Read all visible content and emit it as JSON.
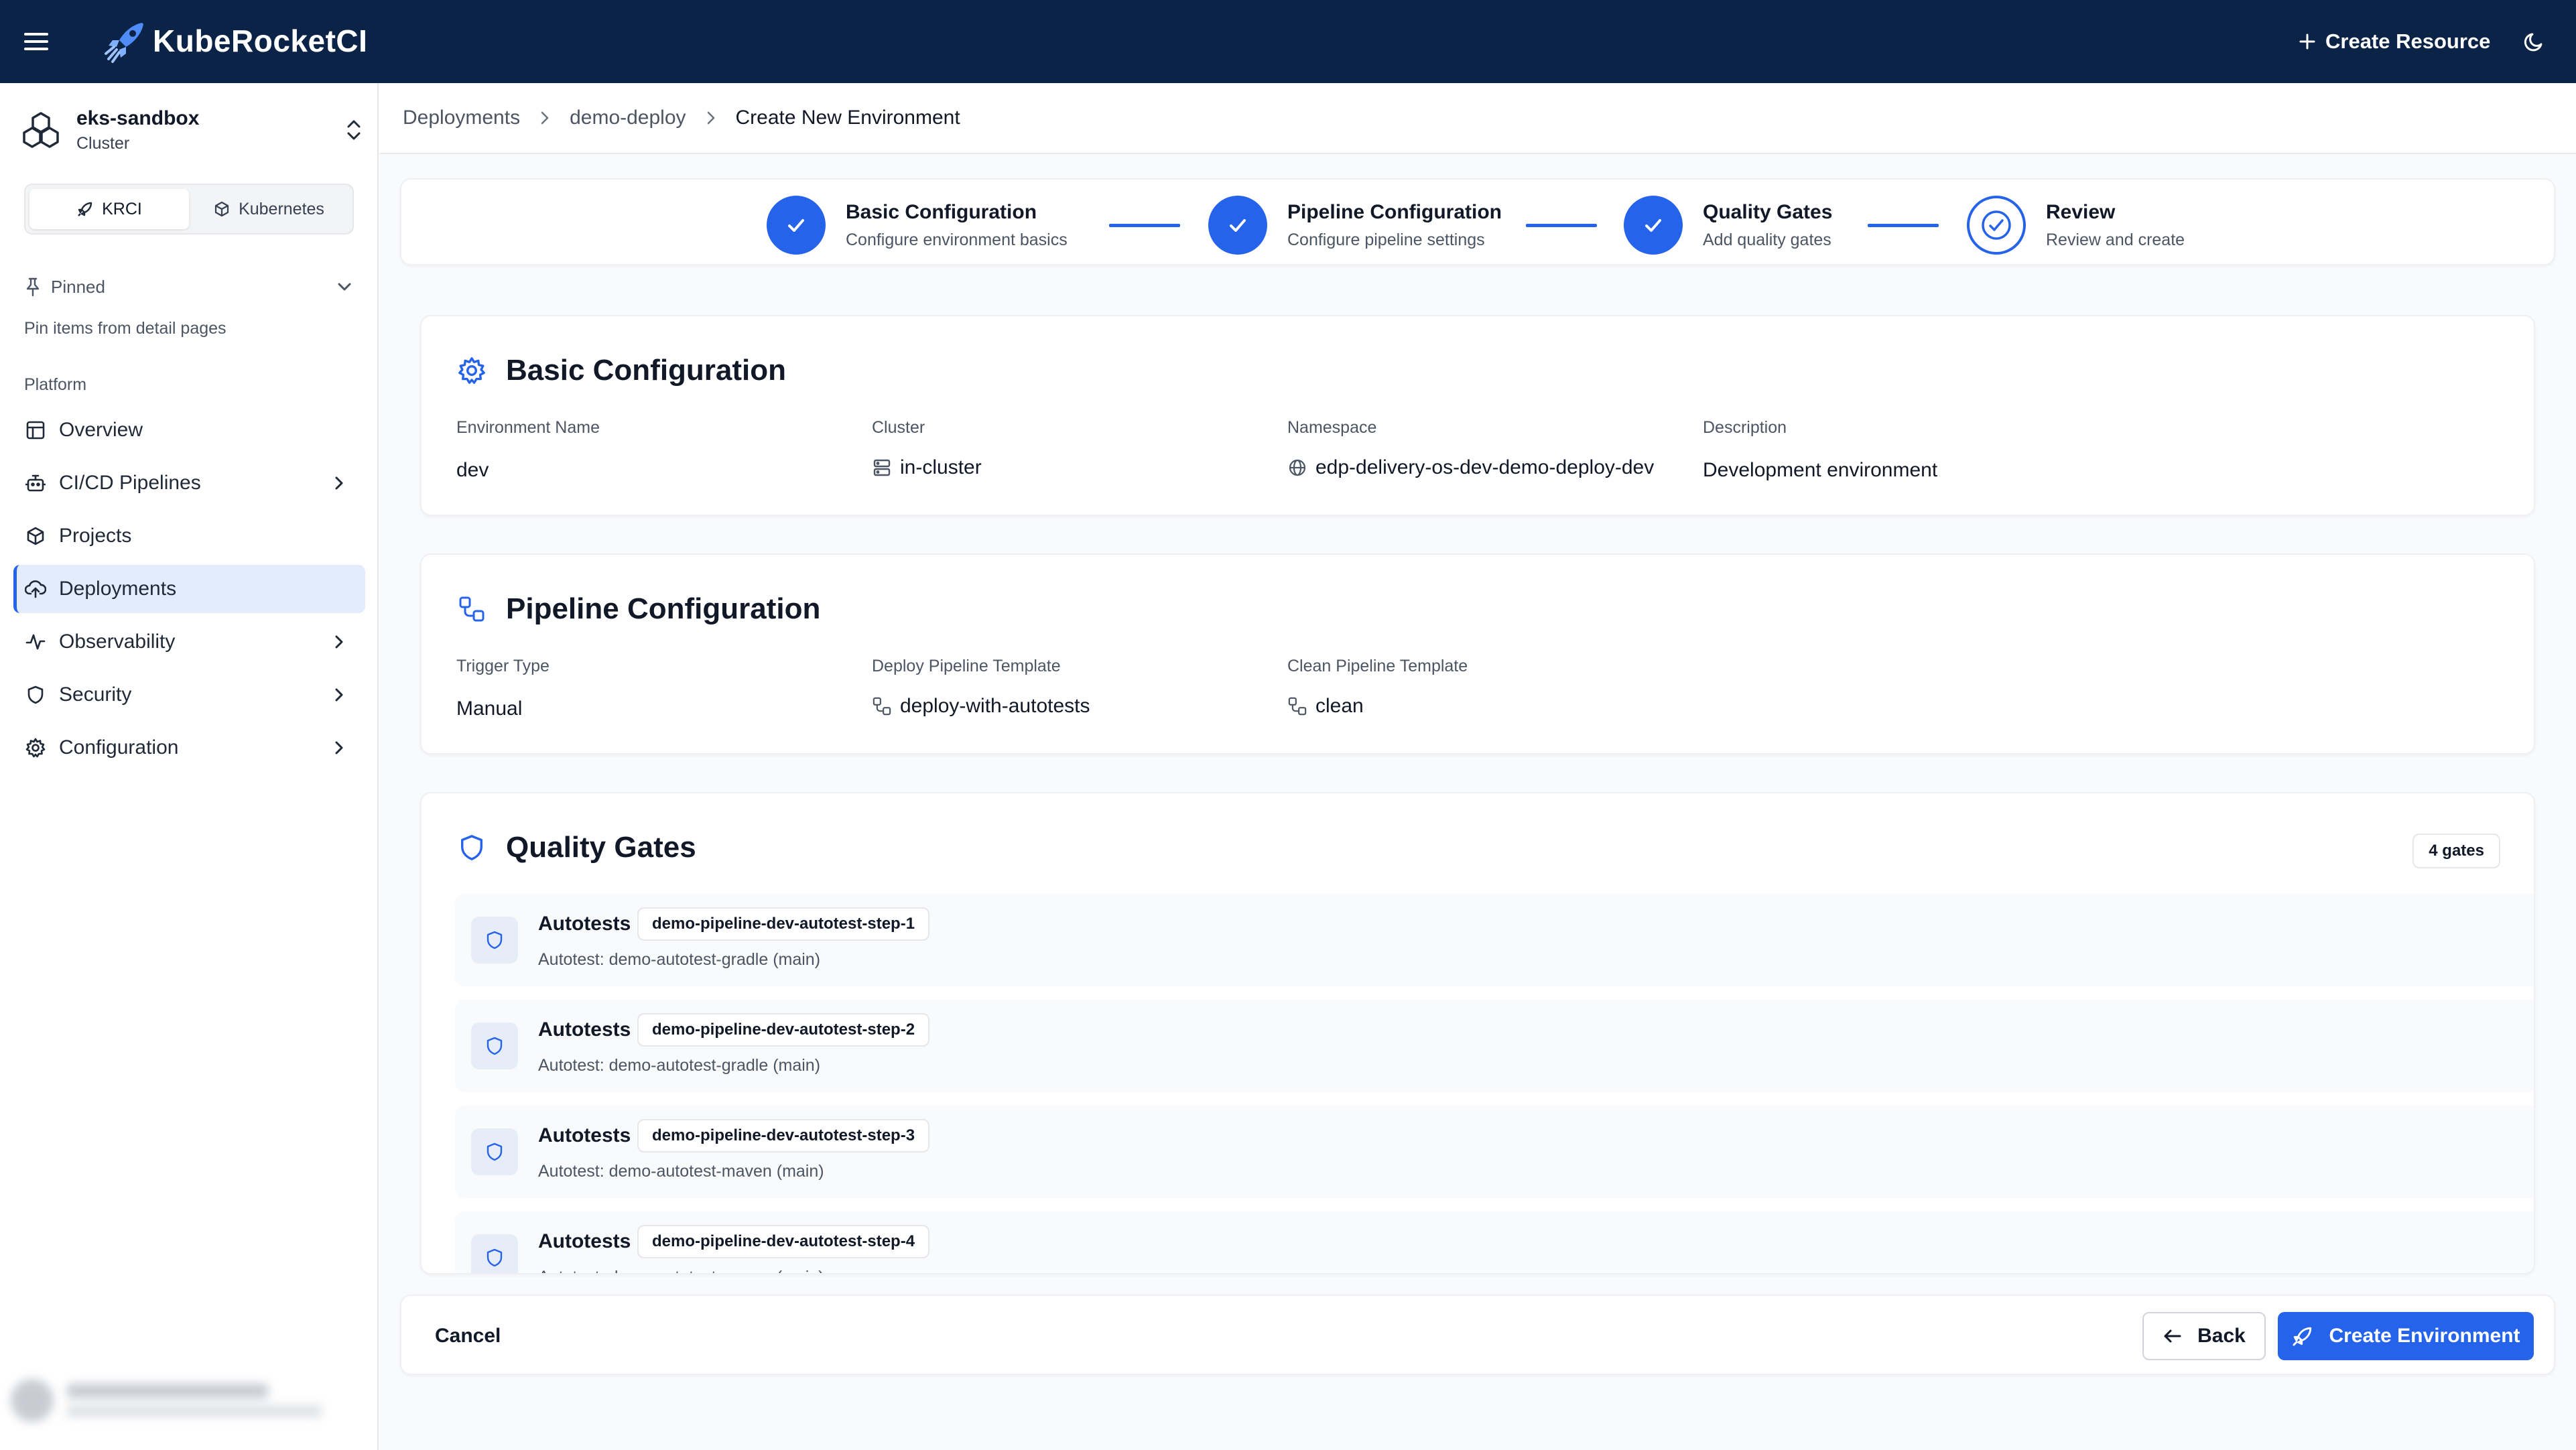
{
  "app": {
    "brand": "KubeRocketCI"
  },
  "topbar": {
    "create_resource": "Create Resource"
  },
  "sidebar": {
    "cluster": {
      "name": "eks-sandbox",
      "type": "Cluster"
    },
    "modes": [
      {
        "label": "KRCI",
        "active": true
      },
      {
        "label": "Kubernetes",
        "active": false
      }
    ],
    "pinned": {
      "label": "Pinned",
      "hint": "Pin items from detail pages"
    },
    "section_label": "Platform",
    "items": [
      {
        "label": "Overview",
        "icon": "layout-icon"
      },
      {
        "label": "CI/CD Pipelines",
        "icon": "bot-icon"
      },
      {
        "label": "Projects",
        "icon": "box-icon"
      },
      {
        "label": "Deployments",
        "icon": "cloud-upload-icon",
        "active": true
      },
      {
        "label": "Observability",
        "icon": "activity-icon"
      },
      {
        "label": "Security",
        "icon": "shield-icon"
      },
      {
        "label": "Configuration",
        "icon": "gear-icon"
      }
    ]
  },
  "breadcrumb": [
    "Deployments",
    "demo-deploy",
    "Create New Environment"
  ],
  "stepper": [
    {
      "title": "Basic Configuration",
      "desc": "Configure environment basics",
      "status": "done"
    },
    {
      "title": "Pipeline Configuration",
      "desc": "Configure pipeline settings",
      "status": "done"
    },
    {
      "title": "Quality Gates",
      "desc": "Add quality gates",
      "status": "done"
    },
    {
      "title": "Review",
      "desc": "Review and create",
      "status": "current"
    }
  ],
  "basic": {
    "title": "Basic Configuration",
    "env_name_label": "Environment Name",
    "env_name": "dev",
    "cluster_label": "Cluster",
    "cluster": "in-cluster",
    "namespace_label": "Namespace",
    "namespace": "edp-delivery-os-dev-demo-deploy-dev",
    "description_label": "Description",
    "description": "Development environment"
  },
  "pipeline": {
    "title": "Pipeline Configuration",
    "trigger_label": "Trigger Type",
    "trigger": "Manual",
    "deploy_label": "Deploy Pipeline Template",
    "deploy": "deploy-with-autotests",
    "clean_label": "Clean Pipeline Template",
    "clean": "clean"
  },
  "gates": {
    "title": "Quality Gates",
    "count_badge": "4 gates",
    "items": [
      {
        "name": "Autotests",
        "step": "demo-pipeline-dev-autotest-step-1",
        "desc": "Autotest: demo-autotest-gradle (main)"
      },
      {
        "name": "Autotests",
        "step": "demo-pipeline-dev-autotest-step-2",
        "desc": "Autotest: demo-autotest-gradle (main)"
      },
      {
        "name": "Autotests",
        "step": "demo-pipeline-dev-autotest-step-3",
        "desc": "Autotest: demo-autotest-maven (main)"
      },
      {
        "name": "Autotests",
        "step": "demo-pipeline-dev-autotest-step-4",
        "desc": "Autotest: demo-autotest-maven (main)"
      }
    ]
  },
  "footer": {
    "cancel": "Cancel",
    "back": "Back",
    "create": "Create Environment"
  },
  "colors": {
    "topbar": "#0b2346",
    "accent": "#2563eb",
    "active_nav": "#e3ecfc"
  }
}
